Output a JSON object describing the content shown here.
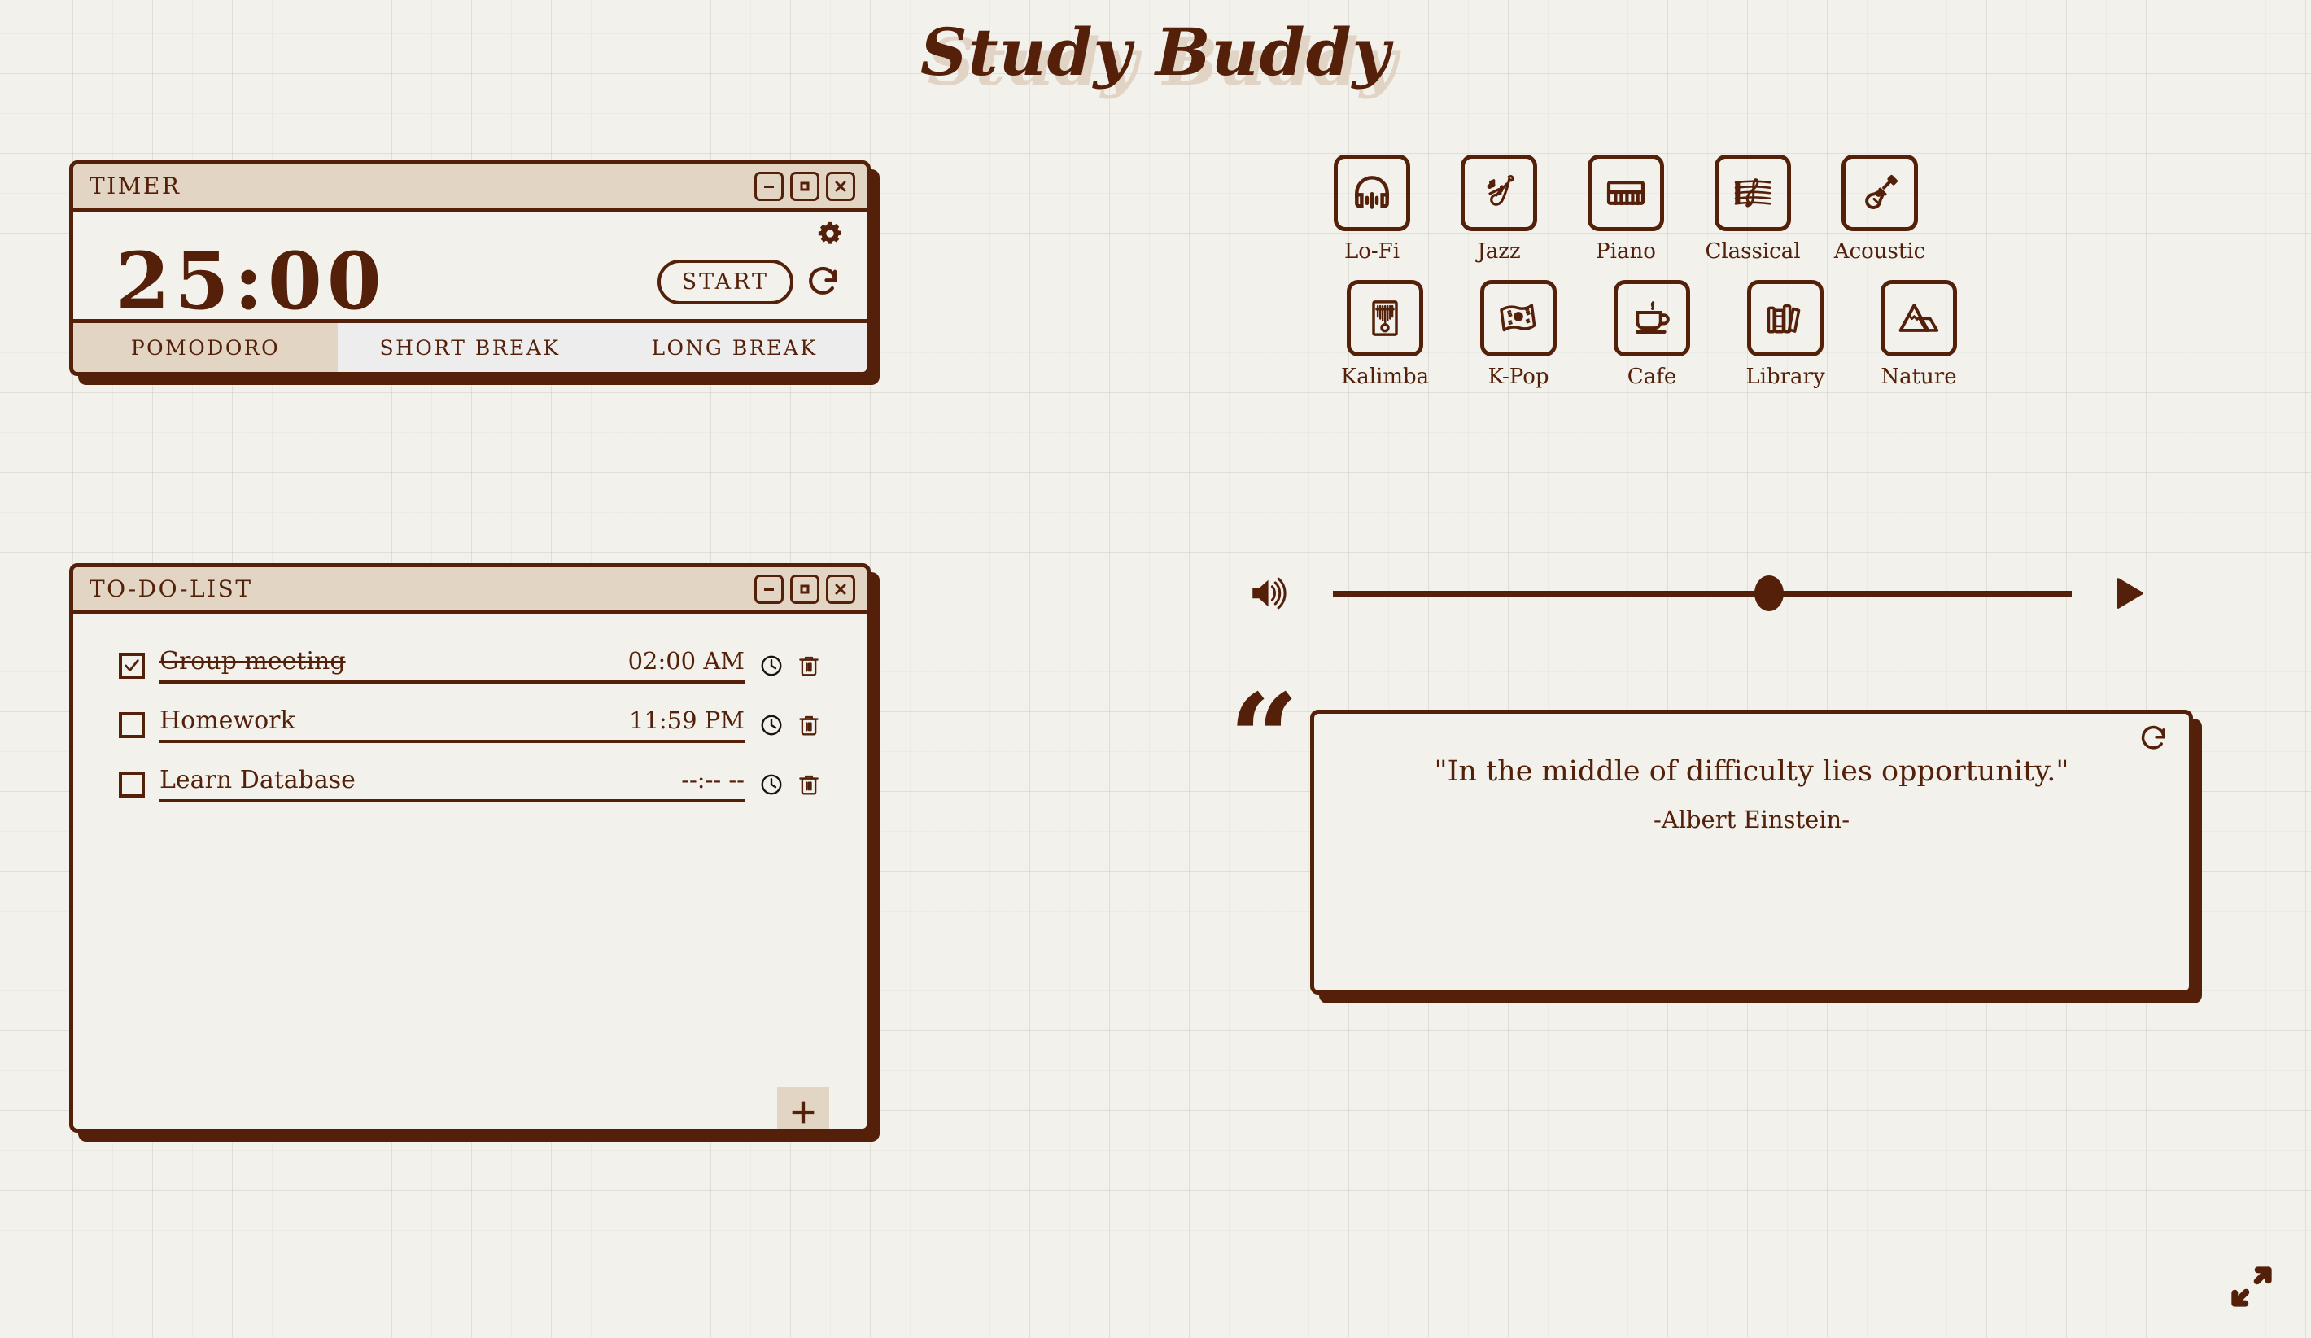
{
  "app": {
    "title": "Study Buddy",
    "accent_color": "#54200a",
    "panel_color": "#e3d5c4",
    "background_color": "#f2f1ec"
  },
  "timer": {
    "window_title": "TIMER",
    "display": "25:00",
    "start_label": "START",
    "settings_icon": "gear-icon",
    "reset_icon": "reset-icon",
    "window_controls": [
      "minimize-icon",
      "maximize-icon",
      "close-icon"
    ],
    "tabs": [
      {
        "label": "POMODORO",
        "active": true
      },
      {
        "label": "SHORT BREAK",
        "active": false
      },
      {
        "label": "LONG BREAK",
        "active": false
      }
    ]
  },
  "todo": {
    "window_title": "TO-DO-LIST",
    "window_controls": [
      "minimize-icon",
      "maximize-icon",
      "close-icon"
    ],
    "add_label": "+",
    "items": [
      {
        "label": "Group meeting",
        "time": "02:00 AM",
        "done": true
      },
      {
        "label": "Homework",
        "time": "11:59 PM",
        "done": false
      },
      {
        "label": "Learn Database",
        "time": "--:-- --",
        "done": false
      }
    ]
  },
  "sounds": {
    "row1": [
      {
        "label": "Lo-Fi",
        "icon": "headphones-icon"
      },
      {
        "label": "Jazz",
        "icon": "saxophone-icon"
      },
      {
        "label": "Piano",
        "icon": "piano-keys-icon"
      },
      {
        "label": "Classical",
        "icon": "music-sheet-icon"
      },
      {
        "label": "Acoustic",
        "icon": "guitar-icon"
      }
    ],
    "row2": [
      {
        "label": "Kalimba",
        "icon": "kalimba-icon"
      },
      {
        "label": "K-Pop",
        "icon": "korean-flag-icon"
      },
      {
        "label": "Cafe",
        "icon": "coffee-cup-icon"
      },
      {
        "label": "Library",
        "icon": "books-icon"
      },
      {
        "label": "Nature",
        "icon": "mountain-icon"
      }
    ]
  },
  "player": {
    "volume_icon": "volume-icon",
    "play_icon": "play-icon",
    "volume_percent": 59
  },
  "quote": {
    "marks": "“",
    "text": "\"In the middle of difficulty lies opportunity.\"",
    "author": "-Albert Einstein-",
    "refresh_icon": "refresh-icon"
  },
  "expand": {
    "icon": "expand-icon"
  }
}
